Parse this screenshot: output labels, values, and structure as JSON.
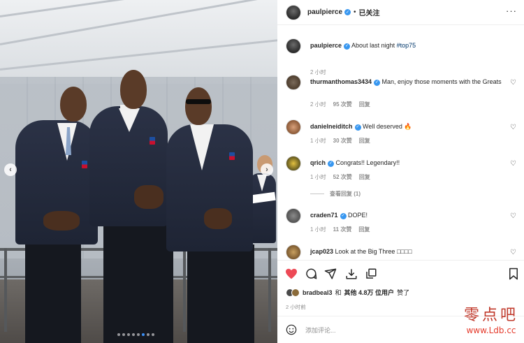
{
  "post": {
    "username": "paulpierce",
    "separator": "•",
    "follow_state": "已关注",
    "caption": "About last night",
    "hashtag": "#top75",
    "caption_time": "2 小时"
  },
  "carousel": {
    "prev_icon": "chevron-left-icon",
    "next_icon": "chevron-right-icon",
    "dot_count": 8,
    "active_dot": 5
  },
  "comments": [
    {
      "user": "thurmanthomas3434",
      "verified": true,
      "text": "Man, enjoy those moments with the Greats",
      "time": "2 小时",
      "likes": "95 次赞",
      "reply": "回复"
    },
    {
      "user": "danielneiditch",
      "verified": true,
      "text": "Well deserved 🔥",
      "time": "1 小时",
      "likes": "30 次赞",
      "reply": "回复"
    },
    {
      "user": "qrich",
      "verified": true,
      "text": "Congrats!! Legendary!!",
      "time": "1 小时",
      "likes": "52 次赞",
      "reply": "回复"
    },
    {
      "user": "craden71",
      "verified": true,
      "text": "DOPE!",
      "time": "1 小时",
      "likes": "11 次赞",
      "reply": "回复"
    },
    {
      "user": "jcap023",
      "verified": false,
      "text": "Look at the Big Three □□□□",
      "time": "",
      "likes": "",
      "reply": ""
    }
  ],
  "view_replies": "查看回复 (1)",
  "likes_line": {
    "user": "bradbeal3",
    "and": "和",
    "others": "其他 4.8万 位用户",
    "liked": "赞了"
  },
  "timestamp": "2 小时前",
  "comment_placeholder": "添加评论...",
  "watermark": {
    "title": "零点吧",
    "url": "www.Ldb.cc"
  },
  "colors": {
    "verified": "#3897f0",
    "like_red": "#ed4956",
    "hashtag": "#00376b",
    "watermark": "#e53b2c"
  }
}
